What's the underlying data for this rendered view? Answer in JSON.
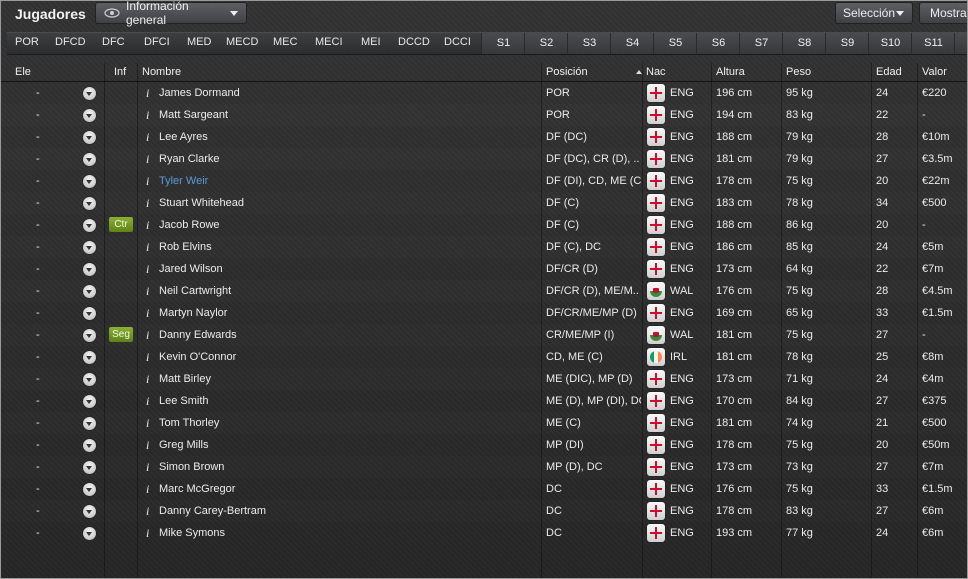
{
  "header": {
    "title": "Jugadores",
    "view_label": "Información general",
    "selection_label": "Selección",
    "show_label": "Mostrar"
  },
  "position_filters": [
    "POR",
    "DFCD",
    "DFC",
    "DFCI",
    "MED",
    "MECD",
    "MEC",
    "MECI",
    "MEI",
    "DCCD",
    "DCCI"
  ],
  "slot_filters": [
    "S1",
    "S2",
    "S3",
    "S4",
    "S5",
    "S6",
    "S7",
    "S8",
    "S9",
    "S10",
    "S11"
  ],
  "columns": {
    "ele": "Ele",
    "inf": "Inf",
    "name": "Nombre",
    "position": "Posición",
    "nation": "Nac",
    "height": "Altura",
    "weight": "Peso",
    "age": "Edad",
    "value": "Valor"
  },
  "rows": [
    {
      "ele": "-",
      "badge": "",
      "info": "i",
      "name": "James Dormand",
      "position": "POR",
      "flag": "eng",
      "nation": "ENG",
      "height": "196 cm",
      "weight": "95 kg",
      "age": "24",
      "value": "€220"
    },
    {
      "ele": "-",
      "badge": "",
      "info": "i",
      "name": "Matt Sargeant",
      "position": "POR",
      "flag": "eng",
      "nation": "ENG",
      "height": "194 cm",
      "weight": "83 kg",
      "age": "22",
      "value": "-"
    },
    {
      "ele": "-",
      "badge": "",
      "info": "i",
      "name": "Lee Ayres",
      "position": "DF (DC)",
      "flag": "eng",
      "nation": "ENG",
      "height": "188 cm",
      "weight": "79 kg",
      "age": "28",
      "value": "€10m"
    },
    {
      "ele": "-",
      "badge": "",
      "info": "i",
      "name": "Ryan Clarke",
      "position": "DF (DC), CR (D), ..",
      "flag": "eng",
      "nation": "ENG",
      "height": "181 cm",
      "weight": "79 kg",
      "age": "27",
      "value": "€3.5m"
    },
    {
      "ele": "-",
      "badge": "",
      "info": "i",
      "name": "Tyler Weir",
      "position": "DF (DI), CD, ME (C)",
      "flag": "eng",
      "nation": "ENG",
      "height": "178 cm",
      "weight": "75 kg",
      "age": "20",
      "value": "€22m",
      "link": true
    },
    {
      "ele": "-",
      "badge": "",
      "info": "i",
      "name": "Stuart Whitehead",
      "position": "DF (C)",
      "flag": "eng",
      "nation": "ENG",
      "height": "183 cm",
      "weight": "78 kg",
      "age": "34",
      "value": "€500"
    },
    {
      "ele": "-",
      "badge": "Ctr",
      "info": "i",
      "name": "Jacob Rowe",
      "position": "DF (C)",
      "flag": "eng",
      "nation": "ENG",
      "height": "188 cm",
      "weight": "86 kg",
      "age": "20",
      "value": "-"
    },
    {
      "ele": "-",
      "badge": "",
      "info": "i",
      "name": "Rob Elvins",
      "position": "DF (C), DC",
      "flag": "eng",
      "nation": "ENG",
      "height": "186 cm",
      "weight": "85 kg",
      "age": "24",
      "value": "€5m"
    },
    {
      "ele": "-",
      "badge": "",
      "info": "i",
      "name": "Jared Wilson",
      "position": "DF/CR (D)",
      "flag": "eng",
      "nation": "ENG",
      "height": "173 cm",
      "weight": "64 kg",
      "age": "22",
      "value": "€7m"
    },
    {
      "ele": "-",
      "badge": "",
      "info": "i",
      "name": "Neil Cartwright",
      "position": "DF/CR (D), ME/M..",
      "flag": "wal",
      "nation": "WAL",
      "height": "176 cm",
      "weight": "75 kg",
      "age": "28",
      "value": "€4.5m"
    },
    {
      "ele": "-",
      "badge": "",
      "info": "i",
      "name": "Martyn Naylor",
      "position": "DF/CR/ME/MP (D)",
      "flag": "eng",
      "nation": "ENG",
      "height": "169 cm",
      "weight": "65 kg",
      "age": "33",
      "value": "€1.5m"
    },
    {
      "ele": "-",
      "badge": "Seg",
      "info": "i",
      "name": "Danny Edwards",
      "position": "CR/ME/MP (I)",
      "flag": "wal",
      "nation": "WAL",
      "height": "181 cm",
      "weight": "75 kg",
      "age": "27",
      "value": "-"
    },
    {
      "ele": "-",
      "badge": "",
      "info": "i",
      "name": "Kevin O'Connor",
      "position": "CD, ME (C)",
      "flag": "irl",
      "nation": "IRL",
      "height": "181 cm",
      "weight": "78 kg",
      "age": "25",
      "value": "€8m"
    },
    {
      "ele": "-",
      "badge": "",
      "info": "i",
      "name": "Matt Birley",
      "position": "ME (DIC), MP (D)",
      "flag": "eng",
      "nation": "ENG",
      "height": "173 cm",
      "weight": "71 kg",
      "age": "24",
      "value": "€4m"
    },
    {
      "ele": "-",
      "badge": "",
      "info": "i",
      "name": "Lee Smith",
      "position": "ME (D), MP (DI), DC",
      "flag": "eng",
      "nation": "ENG",
      "height": "170 cm",
      "weight": "84 kg",
      "age": "27",
      "value": "€375"
    },
    {
      "ele": "-",
      "badge": "",
      "info": "i",
      "name": "Tom Thorley",
      "position": "ME (C)",
      "flag": "eng",
      "nation": "ENG",
      "height": "181 cm",
      "weight": "74 kg",
      "age": "21",
      "value": "€500"
    },
    {
      "ele": "-",
      "badge": "",
      "info": "i",
      "name": "Greg Mills",
      "position": "MP (DI)",
      "flag": "eng",
      "nation": "ENG",
      "height": "178 cm",
      "weight": "75 kg",
      "age": "20",
      "value": "€50m"
    },
    {
      "ele": "-",
      "badge": "",
      "info": "i",
      "name": "Simon Brown",
      "position": "MP (D), DC",
      "flag": "eng",
      "nation": "ENG",
      "height": "173 cm",
      "weight": "73 kg",
      "age": "27",
      "value": "€7m"
    },
    {
      "ele": "-",
      "badge": "",
      "info": "i",
      "name": "Marc McGregor",
      "position": "DC",
      "flag": "eng",
      "nation": "ENG",
      "height": "176 cm",
      "weight": "75 kg",
      "age": "33",
      "value": "€1.5m"
    },
    {
      "ele": "-",
      "badge": "",
      "info": "i",
      "name": "Danny Carey-Bertram",
      "position": "DC",
      "flag": "eng",
      "nation": "ENG",
      "height": "178 cm",
      "weight": "83 kg",
      "age": "27",
      "value": "€6m"
    },
    {
      "ele": "-",
      "badge": "",
      "info": "i",
      "name": "Mike Symons",
      "position": "DC",
      "flag": "eng",
      "nation": "ENG",
      "height": "193 cm",
      "weight": "77 kg",
      "age": "24",
      "value": "€6m"
    }
  ]
}
